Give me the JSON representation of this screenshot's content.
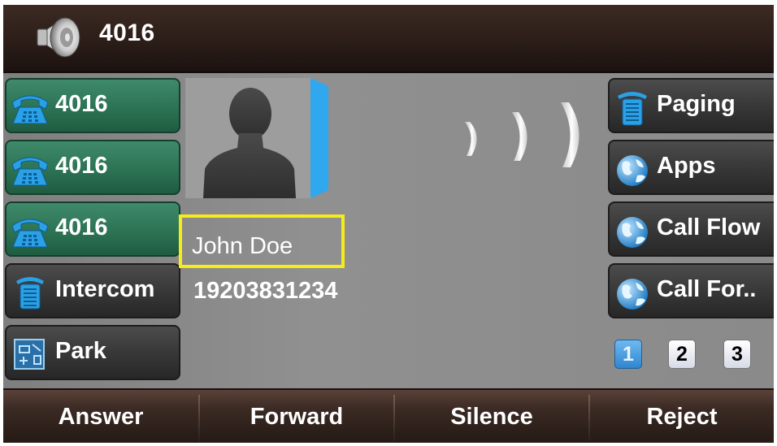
{
  "header": {
    "title": "4016",
    "icon": "speaker-icon"
  },
  "left_keys": [
    {
      "label": "4016",
      "icon": "phone-icon",
      "style": "green"
    },
    {
      "label": "4016",
      "icon": "phone-icon",
      "style": "green"
    },
    {
      "label": "4016",
      "icon": "phone-icon",
      "style": "green"
    },
    {
      "label": "Intercom",
      "icon": "intercom-icon",
      "style": "dark"
    },
    {
      "label": "Park",
      "icon": "park-icon",
      "style": "dark"
    }
  ],
  "caller": {
    "name": "John Doe",
    "number": "19203831234"
  },
  "right_keys": [
    {
      "label": "Paging",
      "icon": "paging-icon"
    },
    {
      "label": "Apps",
      "icon": "globe-icon"
    },
    {
      "label": "Call Flow",
      "icon": "globe-icon"
    },
    {
      "label": "Call For..",
      "icon": "globe-icon"
    }
  ],
  "pages": {
    "items": [
      "1",
      "2",
      "3"
    ],
    "active": "1"
  },
  "softkeys": [
    "Answer",
    "Forward",
    "Silence",
    "Reject"
  ],
  "colors": {
    "highlight": "#f5ec1a",
    "line_key_active": "#2e7556",
    "accent_blue": "#2fa8f0"
  }
}
